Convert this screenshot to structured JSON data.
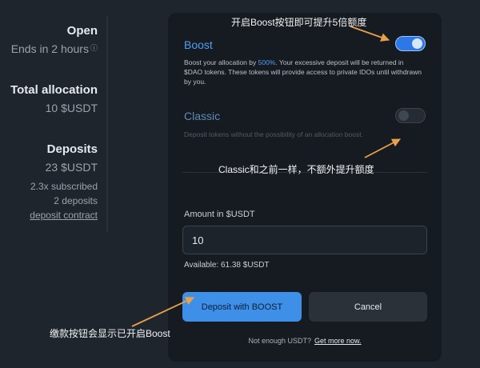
{
  "left": {
    "status_title": "Open",
    "status_value": "Ends in 2 hours",
    "info_icon": "ⓘ",
    "allocation_title": "Total allocation",
    "allocation_value": "10 $USDT",
    "deposits_title": "Deposits",
    "deposits_value": "23 $USDT",
    "subscribed": "2.3x subscribed",
    "deposit_count": "2 deposits",
    "contract_link": "deposit contract"
  },
  "modal": {
    "boost": {
      "title": "Boost",
      "desc_pre": "Boost your allocation by ",
      "desc_pct": "500%",
      "desc_post": ". Your excessive deposit will be returned in $DAO tokens. These tokens will provide access to private IDOs until withdrawn by you.",
      "enabled": true
    },
    "classic": {
      "title": "Classic",
      "desc": "Deposit tokens without the possibility of an allocation boost.",
      "enabled": false
    },
    "amount_label": "Amount in $USDT",
    "amount_value": "10",
    "available": "Available: 61.38 $USDT",
    "deposit_button": "Deposit with BOOST",
    "cancel_button": "Cancel",
    "footer_text": "Not enough USDT?",
    "footer_link": "Get more now."
  },
  "annotations": {
    "boost_note": "开启Boost按钮即可提升5倍额度",
    "classic_note": "Classic和之前一样，不额外提升额度",
    "deposit_note": "缴款按钮会显示已开启Boost",
    "arrow_color": "#e8a04a"
  },
  "colors": {
    "background": "#1f252d",
    "modal": "#161b21",
    "accent": "#3d8fe8"
  }
}
